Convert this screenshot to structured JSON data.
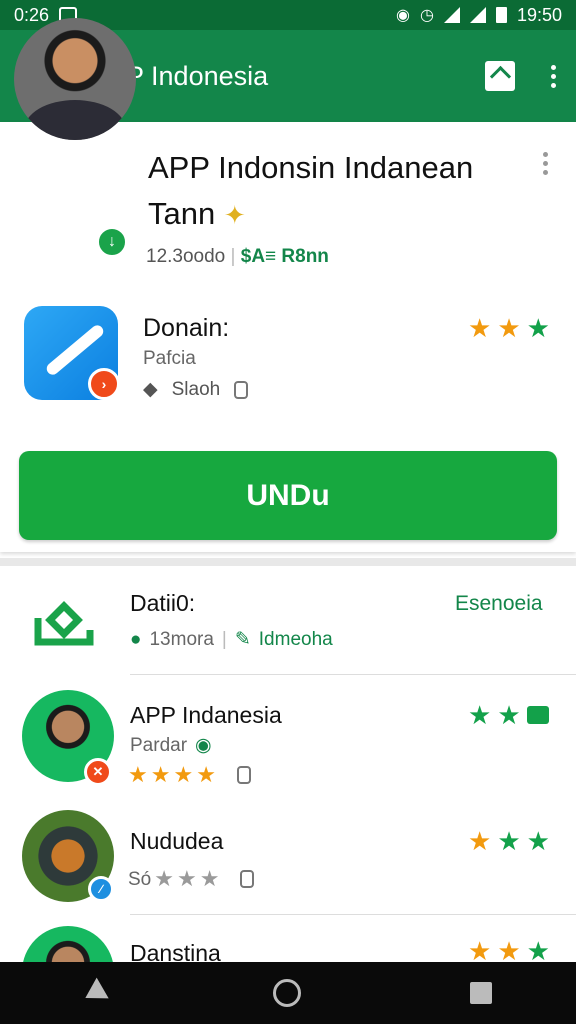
{
  "status_bar": {
    "time_left": "0:26",
    "time_right": "19:50"
  },
  "app_bar": {
    "title": "APP Indonesia"
  },
  "hero": {
    "title": "APP Indonsin Indanean Tann",
    "meta_count": "12.3oodo",
    "meta_tag": "$A≡ R8nn",
    "app_name": "Donain:",
    "app_sub": "Pafcia",
    "app_size": "Slaoh",
    "install_label": "UNDu"
  },
  "list": {
    "header": {
      "title": "Datii0:",
      "link": "Esenoeia",
      "sub1": "13mora",
      "sub2": "Idmeoha"
    },
    "items": [
      {
        "title": "APP Indanesia",
        "sub": "Pardar"
      },
      {
        "title": "Nududea",
        "sub": "Só"
      },
      {
        "title": "Danstina"
      }
    ]
  },
  "colors": {
    "primary": "#13864a",
    "status_bar": "#0b6b35",
    "install": "#17a83f",
    "star_orange": "#f29a0f",
    "star_green": "#13a14a"
  }
}
